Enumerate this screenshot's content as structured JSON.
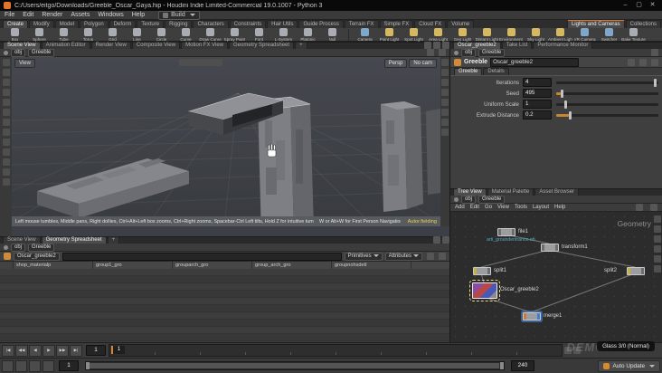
{
  "icons": {
    "minimize": "–",
    "maximize": "▢",
    "close": "✕",
    "to_start": "|◀",
    "fast_back": "◀◀",
    "step_back": "◀",
    "play": "▶",
    "step_fwd": "▶▶",
    "to_end": "▶|",
    "plus": "+"
  },
  "window": {
    "title": "C:/Users/eitgo/Downloads/Greeble_Oscar_Gaya.hip - Houdini Indie Limited-Commercial 19.0.1007 - Python 3"
  },
  "menubar": {
    "items": [
      "File",
      "Edit",
      "Render",
      "Assets",
      "Windows",
      "Help"
    ],
    "desktop": "Build"
  },
  "shelf": {
    "tabs": [
      "Create",
      "Modify",
      "Model",
      "Polygon",
      "Deform",
      "Texture",
      "Rigging",
      "Characters",
      "Constraints",
      "Hair Utils",
      "Guide Process",
      "Terrain FX",
      "Simple FX",
      "Cloud FX",
      "Volume"
    ],
    "right_tabs": [
      "Lights and Cameras",
      "Collections"
    ],
    "tools": [
      "Box",
      "Sphere",
      "Tube",
      "Torus",
      "Grid",
      "Line",
      "Circle",
      "Curve",
      "Draw Curve",
      "Spray Paint",
      "Font",
      "L-System",
      "Platonic",
      "Null"
    ],
    "light_tools": [
      "Camera",
      "Point Light",
      "Spot Light",
      "Area Light",
      "Geo Light",
      "Distant Light",
      "Environment Light",
      "Sky Light",
      "Ambient Light",
      "VR Camera",
      "Switcher",
      "Bake Texture"
    ]
  },
  "scene": {
    "pane_tabs": [
      "Scene View",
      "Animation Editor",
      "Render View",
      "Composite View",
      "Motion FX View",
      "Geometry Spreadsheet"
    ],
    "path": [
      "obj",
      "Greeble"
    ],
    "view_button": "View",
    "persp": "Persp",
    "no_cam": "No cam",
    "help_1": "Left mouse tumbles, Middle pans, Right dollies, Ctrl+Alt+Left box zooms, Ctrl+Right zooms, Spacebar-Ctrl Left tilts, Hold Z for intuitive tumble, dolly, and zooms.",
    "help_2": "W or Alt+W for First Person Navigation",
    "overlay_name": "Autor.fielding"
  },
  "params": {
    "pane_tabs": [
      "Oscar_greeble2",
      "Take List",
      "Performance Monitor"
    ],
    "path": [
      "obj",
      "Greeble"
    ],
    "node_type": "Greeble",
    "node_name": "Oscar_greeble2",
    "folder_tabs": [
      "Greeble",
      "Details"
    ],
    "rows": [
      {
        "label": "Iterations",
        "value": "4"
      },
      {
        "label": "Seed",
        "value": "495"
      },
      {
        "label": "Uniform Scale",
        "value": "1"
      },
      {
        "label": "Extrude Distance",
        "value": "0.2"
      }
    ]
  },
  "spreadsheet": {
    "pane_tabs": [
      "Scene View",
      "Geometry Spreadsheet"
    ],
    "path": [
      "obj",
      "Greeble"
    ],
    "node_name": "Oscar_greeble2",
    "view_dropdown": "Primitives",
    "filter_label": "Attributes",
    "columns": [
      "shop_materialp",
      "group1_gro",
      "grouparch_gro",
      "group_arch_gro",
      "groupnohsdetl"
    ]
  },
  "network": {
    "pane_tabs": [
      "Tree View",
      "Material Palette",
      "Asset Browser"
    ],
    "path": [
      "obj",
      "Greeble"
    ],
    "menus": [
      "Add",
      "Edit",
      "Go",
      "View",
      "Tools",
      "Layout",
      "Help"
    ],
    "context_label": "Geometry",
    "nodes": [
      {
        "name": "file1",
        "comment": "arti_groundentrance.ob"
      },
      {
        "name": "transform1"
      },
      {
        "name": "split1"
      },
      {
        "name": "split2"
      },
      {
        "name": "Oscar_greeble2"
      },
      {
        "name": "merge1"
      }
    ]
  },
  "playbar": {
    "frame": "1",
    "range_start": "1",
    "range_end": "240",
    "auto_update": "Auto Update",
    "badge": "Glass 3/0 (Normal)",
    "watermark": "DEMONGO"
  }
}
